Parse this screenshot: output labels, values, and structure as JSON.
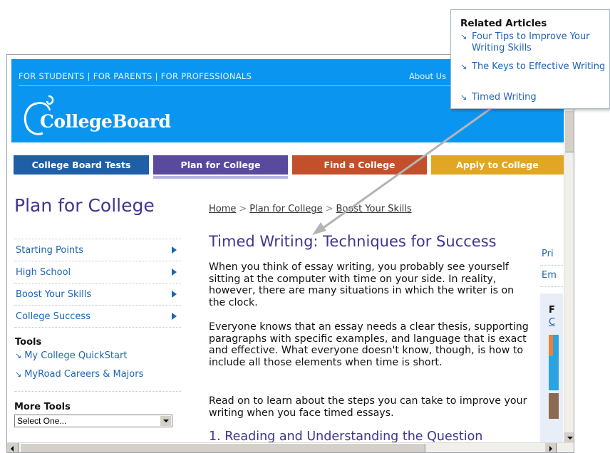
{
  "header": {
    "audience_links": "FOR STUDENTS | FOR PARENTS | FOR PROFESSIONALS",
    "about_us": "About Us",
    "logo_text": "CollegeBoard"
  },
  "nav": {
    "tabs": [
      {
        "label": "College Board Tests",
        "color": "#1f5fa8"
      },
      {
        "label": "Plan for College",
        "color": "#5a4a9e"
      },
      {
        "label": "Find a College",
        "color": "#c2502a"
      },
      {
        "label": "Apply to College",
        "color": "#e0a624"
      }
    ]
  },
  "sidebar": {
    "section_title": "Plan for College",
    "items": [
      {
        "label": "Starting Points"
      },
      {
        "label": "High School"
      },
      {
        "label": "Boost Your Skills"
      },
      {
        "label": "College Success"
      }
    ],
    "tools_title": "Tools",
    "tools": [
      {
        "label": "My College QuickStart"
      },
      {
        "label": "MyRoad Careers & Majors"
      }
    ],
    "more_tools_title": "More Tools",
    "more_tools_selected": "Select One..."
  },
  "breadcrumb": {
    "home": "Home",
    "sep": ">",
    "plan": "Plan for College",
    "boost": "Boost Your Skills"
  },
  "article": {
    "title": "Timed Writing: Techniques for Success",
    "paragraphs": [
      "When you think of essay writing, you probably see yourself sitting at the computer with time on your side. In reality, however, there are many situations in which the writer is on the clock.",
      "Everyone knows that an essay needs a clear thesis, supporting paragraphs with specific examples, and language that is exact and effective. What everyone doesn't know, though, is how to include all those elements when time is short.",
      "Read on to learn about the steps you can take to improve your writing when you face timed essays."
    ],
    "subhead": "1. Reading and Understanding the Question"
  },
  "right_column": {
    "print": "Pri",
    "email": "Em",
    "promo_letter_f": "F",
    "promo_letter_c": "C"
  },
  "popup": {
    "title": "Related Articles",
    "links": [
      {
        "label": "Four Tips to Improve Your Writing Skills"
      },
      {
        "label": "The Keys to Effective Writing"
      },
      {
        "label": "Timed Writing"
      }
    ],
    "arrow_glyph": "↘"
  }
}
